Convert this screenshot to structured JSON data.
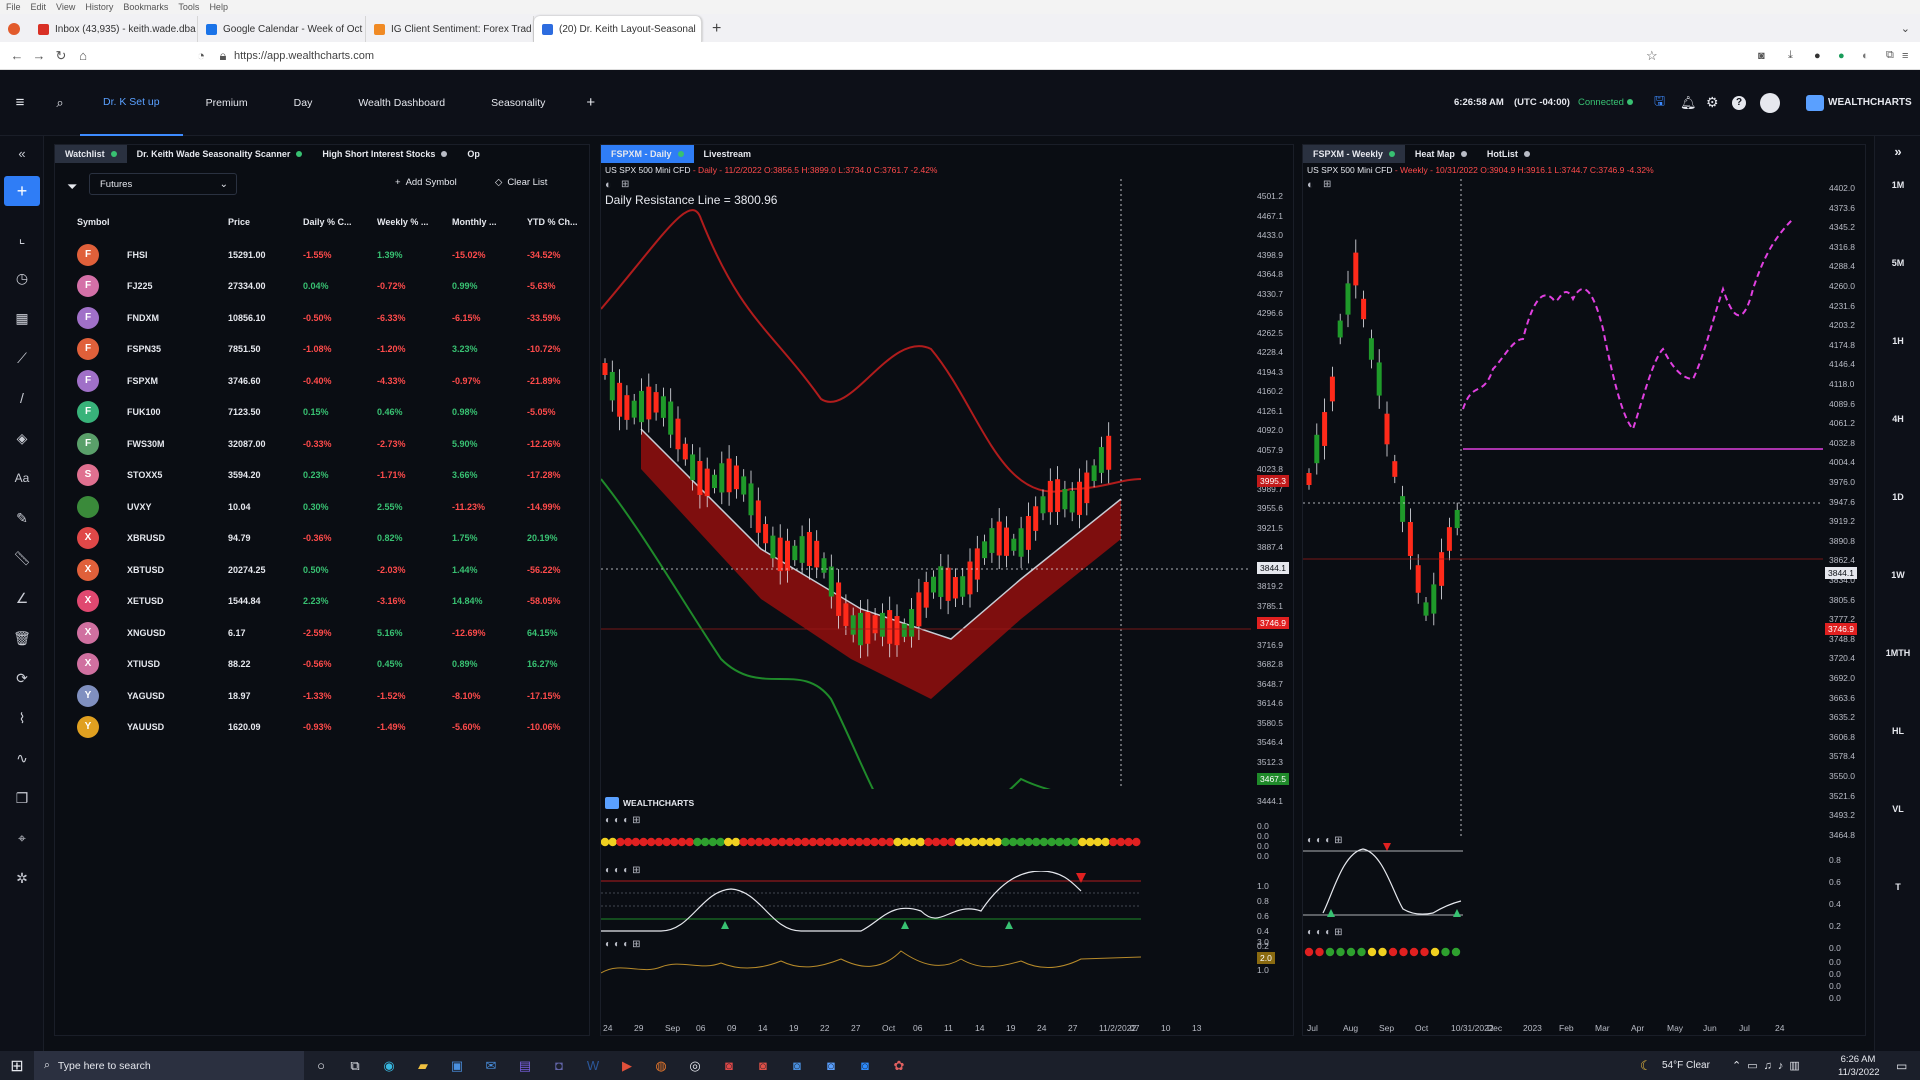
{
  "browser": {
    "menu": [
      "File",
      "Edit",
      "View",
      "History",
      "Bookmarks",
      "Tools",
      "Help"
    ],
    "tabs": [
      {
        "label": "Inbox (43,935) - keith.wade.dba",
        "color": "#d93025"
      },
      {
        "label": "Google Calendar - Week of Oct",
        "color": "#1a73e8"
      },
      {
        "label": "IG Client Sentiment: Forex Trad",
        "color": "#f08a24"
      },
      {
        "label": "(20) Dr. Keith Layout-Seasonal",
        "color": "#2d6cdf"
      }
    ],
    "new_tab": "+",
    "url": "https://app.wealthcharts.com"
  },
  "app": {
    "tabs": [
      "Dr. K Set up",
      "Premium",
      "Day",
      "Wealth Dashboard",
      "Seasonality"
    ],
    "add_tab": "+",
    "time": "6:26:58 AM",
    "tz": "(UTC -04:00)",
    "status": "Connected",
    "brand": "WEALTHCHARTS"
  },
  "left_tools": [
    "+",
    "chart",
    "clock",
    "calendar",
    "trend",
    "line",
    "shapes",
    "Aa",
    "pen",
    "ruler",
    "angle",
    "trash",
    "sync",
    "stats",
    "wave",
    "layers",
    "target",
    "gear"
  ],
  "timeframes": [
    "1M",
    "5M",
    "1H",
    "4H",
    "1D",
    "1W",
    "1MTH",
    "HL",
    "VL",
    "T"
  ],
  "watchlist": {
    "tabs": [
      "Watchlist",
      "Dr. Keith Wade Seasonality Scanner",
      "High Short Interest Stocks",
      "Op"
    ],
    "filter": "Futures",
    "add_symbol": "Add Symbol",
    "clear_list": "Clear List",
    "columns": [
      "Symbol",
      "Price",
      "Daily % C...",
      "Weekly % ...",
      "Monthly ...",
      "YTD % Ch..."
    ],
    "rows": [
      {
        "l": "F",
        "sym": "FHSI",
        "price": "15291.00",
        "d": "-1.55%",
        "w": "1.39%",
        "m": "-15.02%",
        "y": "-34.52%",
        "c": "#e0603a"
      },
      {
        "l": "F",
        "sym": "FJ225",
        "price": "27334.00",
        "d": "0.04%",
        "w": "-0.72%",
        "m": "0.99%",
        "y": "-5.63%",
        "c": "#d470a8"
      },
      {
        "l": "F",
        "sym": "FNDXM",
        "price": "10856.10",
        "d": "-0.50%",
        "w": "-6.33%",
        "m": "-6.15%",
        "y": "-33.59%",
        "c": "#a070c8"
      },
      {
        "l": "F",
        "sym": "FSPN35",
        "price": "7851.50",
        "d": "-1.08%",
        "w": "-1.20%",
        "m": "3.23%",
        "y": "-10.72%",
        "c": "#e0603a"
      },
      {
        "l": "F",
        "sym": "FSPXM",
        "price": "3746.60",
        "d": "-0.40%",
        "w": "-4.33%",
        "m": "-0.97%",
        "y": "-21.89%",
        "c": "#a070c8"
      },
      {
        "l": "F",
        "sym": "FUK100",
        "price": "7123.50",
        "d": "0.15%",
        "w": "0.46%",
        "m": "0.98%",
        "y": "-5.05%",
        "c": "#38b37a"
      },
      {
        "l": "F",
        "sym": "FWS30M",
        "price": "32087.00",
        "d": "-0.33%",
        "w": "-2.73%",
        "m": "5.90%",
        "y": "-12.26%",
        "c": "#5aa06a"
      },
      {
        "l": "S",
        "sym": "STOXX5",
        "price": "3594.20",
        "d": "0.23%",
        "w": "-1.71%",
        "m": "3.66%",
        "y": "-17.28%",
        "c": "#e07090"
      },
      {
        "l": "",
        "sym": "UVXY",
        "price": "10.04",
        "d": "0.30%",
        "w": "2.55%",
        "m": "-11.23%",
        "y": "-14.99%",
        "c": "#3a8a3a"
      },
      {
        "l": "X",
        "sym": "XBRUSD",
        "price": "94.79",
        "d": "-0.36%",
        "w": "0.82%",
        "m": "1.75%",
        "y": "20.19%",
        "c": "#e04848"
      },
      {
        "l": "X",
        "sym": "XBTUSD",
        "price": "20274.25",
        "d": "0.50%",
        "w": "-2.03%",
        "m": "1.44%",
        "y": "-56.22%",
        "c": "#e0603a"
      },
      {
        "l": "X",
        "sym": "XETUSD",
        "price": "1544.84",
        "d": "2.23%",
        "w": "-3.16%",
        "m": "14.84%",
        "y": "-58.05%",
        "c": "#e04870"
      },
      {
        "l": "X",
        "sym": "XNGUSD",
        "price": "6.17",
        "d": "-2.59%",
        "w": "5.16%",
        "m": "-12.69%",
        "y": "64.15%",
        "c": "#d070a0"
      },
      {
        "l": "X",
        "sym": "XTIUSD",
        "price": "88.22",
        "d": "-0.56%",
        "w": "0.45%",
        "m": "0.89%",
        "y": "16.27%",
        "c": "#d070a0"
      },
      {
        "l": "Y",
        "sym": "YAGUSD",
        "price": "18.97",
        "d": "-1.33%",
        "w": "-1.52%",
        "m": "-8.10%",
        "y": "-17.15%",
        "c": "#8090c0"
      },
      {
        "l": "Y",
        "sym": "YAUUSD",
        "price": "1620.09",
        "d": "-0.93%",
        "w": "-1.49%",
        "m": "-5.60%",
        "y": "-10.06%",
        "c": "#e0a020"
      }
    ]
  },
  "daily_chart": {
    "tabs": [
      "FSPXM - Daily",
      "Livestream"
    ],
    "info_prefix": "US SPX 500 Mini CFD",
    "info": " - Daily - 11/2/2022 O:3856.5 H:3899.0 L:3734.0 C:3761.7 -2.42%",
    "annotation": "Daily Resistance Line = 3800.96",
    "yticks": [
      "4501.2",
      "4467.1",
      "4433.0",
      "4398.9",
      "4364.8",
      "4330.7",
      "4296.6",
      "4262.5",
      "4228.4",
      "4194.3",
      "4160.2",
      "4126.1",
      "4092.0",
      "4057.9",
      "4023.8",
      "3989.7",
      "3955.6",
      "3921.5",
      "3887.4",
      "3853.3",
      "3819.2",
      "3785.1",
      "3751.0",
      "3716.9",
      "3682.8",
      "3648.7",
      "3614.6",
      "3580.5",
      "3546.4",
      "3512.3",
      "3478.2",
      "3444.1"
    ],
    "tag_red": "3995.3",
    "tag_cross": "3844.1",
    "tag_last": "3746.9",
    "tag_green": "3467.5",
    "xticks": [
      "24",
      "29",
      "Sep",
      "06",
      "09",
      "14",
      "19",
      "22",
      "27",
      "Oct",
      "06",
      "11",
      "14",
      "19",
      "24",
      "27",
      "11/2/2022",
      "07",
      "10",
      "13"
    ],
    "logo": "WEALTHCHARTS",
    "osc1_ticks": [
      "0.0",
      "0.0",
      "0.0",
      "0.0"
    ],
    "osc2_ticks": [
      "1.0",
      "0.8",
      "0.6",
      "0.4",
      "0.2",
      "0.0"
    ],
    "osc3_ticks": [
      "3.0",
      "1.0"
    ],
    "osc3_tag": "2.0"
  },
  "weekly_chart": {
    "tabs": [
      "FSPXM - Weekly",
      "Heat Map",
      "HotList"
    ],
    "info_prefix": "US SPX 500 Mini CFD",
    "info": " - Weekly - 10/31/2022 O:3904.9 H:3916.1 L:3744.7 C:3746.9 -4.32%",
    "yticks": [
      "4402.0",
      "4373.6",
      "4345.2",
      "4316.8",
      "4288.4",
      "4260.0",
      "4231.6",
      "4203.2",
      "4174.8",
      "4146.4",
      "4118.0",
      "4089.6",
      "4061.2",
      "4032.8",
      "4004.4",
      "3976.0",
      "3947.6",
      "3919.2",
      "3890.8",
      "3862.4",
      "3834.0",
      "3805.6",
      "3777.2",
      "3748.8",
      "3720.4",
      "3692.0",
      "3663.6",
      "3635.2",
      "3606.8",
      "3578.4",
      "3550.0",
      "3521.6",
      "3493.2",
      "3464.8"
    ],
    "tag_cross": "3844.1",
    "tag_last": "3746.9",
    "xticks": [
      "Jul",
      "Aug",
      "Sep",
      "Oct",
      "10/31/2022",
      "Dec",
      "2023",
      "Feb",
      "Mar",
      "Apr",
      "May",
      "Jun",
      "Jul",
      "24"
    ],
    "osc_ticks": [
      "0.8",
      "0.6",
      "0.4",
      "0.2",
      "0.0"
    ],
    "osc2_ticks": [
      "0.0",
      "0.0",
      "0.0",
      "0.0"
    ]
  },
  "taskbar": {
    "search": "Type here to search",
    "weather": "54°F  Clear",
    "time": "6:26 AM",
    "date": "11/3/2022"
  }
}
